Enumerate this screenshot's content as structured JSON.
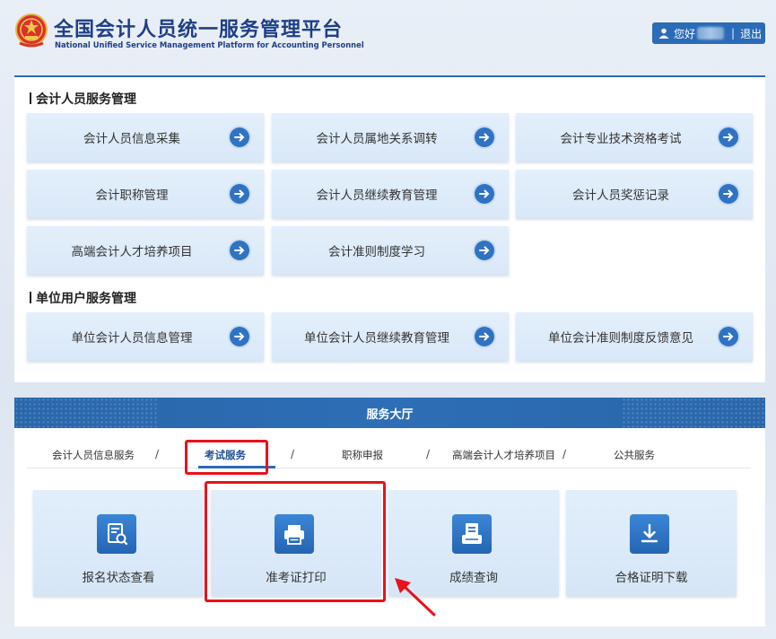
{
  "header": {
    "title_cn": "全国会计人员统一服务管理平台",
    "title_en": "National Unified Service Management Platform for Accounting Personnel",
    "greeting": "您好",
    "separator": "|",
    "logout": "退出"
  },
  "sections": [
    {
      "title": "会计人员服务管理"
    },
    {
      "title": "单位用户服务管理"
    }
  ],
  "cards": [
    "会计人员信息采集",
    "会计人员属地关系调转",
    "会计专业技术资格考试",
    "会计职称管理",
    "会计人员继续教育管理",
    "会计人员奖惩记录",
    "高端会计人才培养项目",
    "会计准则制度学习",
    "单位会计人员信息管理",
    "单位会计人员继续教育管理",
    "单位会计准则制度反馈意见"
  ],
  "hall": {
    "title": "服务大厅",
    "tabs": [
      "会计人员信息服务",
      "考试服务",
      "职称申报",
      "高端会计人才培养项目",
      "公共服务"
    ],
    "slash": "/",
    "active_tab": "考试服务",
    "services": [
      {
        "label": "报名状态查看",
        "icon": "document-search-icon"
      },
      {
        "label": "准考证打印",
        "icon": "printer-icon"
      },
      {
        "label": "成绩查询",
        "icon": "report-icon"
      },
      {
        "label": "合格证明下载",
        "icon": "download-icon"
      }
    ]
  },
  "colors": {
    "brand": "#2b6bb7",
    "highlight": "#e8121b",
    "card_bg": "#dde9f8"
  }
}
